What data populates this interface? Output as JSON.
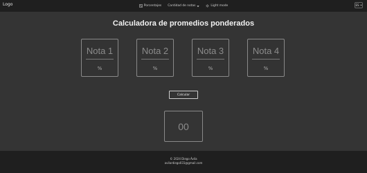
{
  "header": {
    "logo": "Logo",
    "nav": [
      {
        "label": "Porcentajes",
        "icon": "percent-icon"
      },
      {
        "label": "Cantidad de notas",
        "icon": "chevron-down-icon"
      },
      {
        "label": "Light mode",
        "icon": "sun-icon"
      }
    ],
    "language": "ES"
  },
  "main": {
    "title": "Calculadora de promedios ponderados",
    "cards": [
      {
        "label": "Nota 1",
        "unit": "%"
      },
      {
        "label": "Nota 2",
        "unit": "%"
      },
      {
        "label": "Nota 3",
        "unit": "%"
      },
      {
        "label": "Nota 4",
        "unit": "%"
      }
    ],
    "calculate_label": "Calcular",
    "result": "00"
  },
  "footer": {
    "copyright": "© 2024 Diego Ávila",
    "email": "avilardiego031@gmail.com"
  }
}
